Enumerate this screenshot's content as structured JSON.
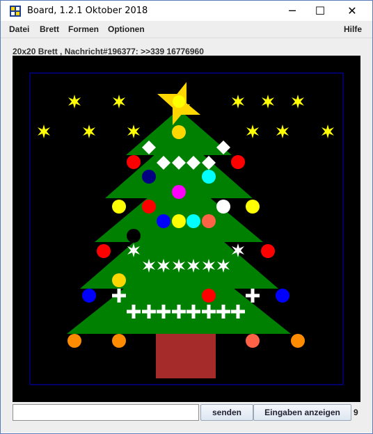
{
  "window": {
    "title": "Board, 1.2.1 Oktober 2018",
    "minimize_glyph": "─",
    "maximize_glyph": "☐",
    "close_glyph": "✕",
    "app_icon": "board-grid-icon"
  },
  "menu": {
    "items": [
      "Datei",
      "Brett",
      "Formen",
      "Optionen"
    ],
    "help": "Hilfe"
  },
  "status_text": "20x20 Brett , Nachricht#196377: >>339 16776960",
  "board": {
    "grid_size": 20,
    "background": "#000000",
    "frame_color": "#0000cc",
    "tree_color": "#008000",
    "trunk_color": "#a52a2a",
    "ornament_colors": {
      "yellow": "#ffff00",
      "red": "#ff0000",
      "blue": "#0000ff",
      "navy": "#000080",
      "cyan": "#00ffff",
      "magenta": "#ff00ff",
      "white": "#ffffff",
      "black": "#000000",
      "orange": "#ff8c00",
      "salmon": "#ff6347",
      "gold": "#ffd700"
    }
  },
  "footer": {
    "input_value": "",
    "send_label": "senden",
    "show_inputs_label": "Eingaben anzeigen",
    "count": "9"
  }
}
